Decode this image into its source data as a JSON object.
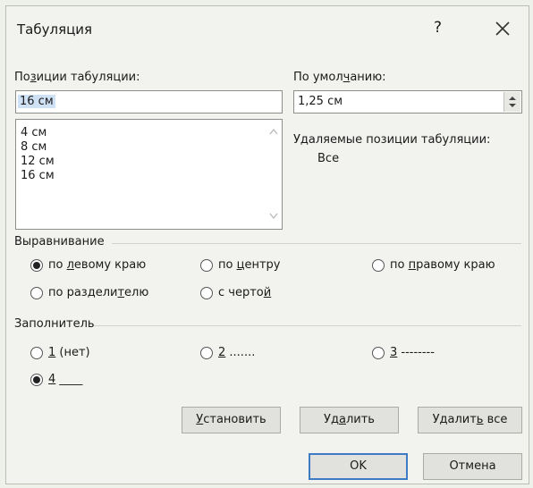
{
  "dialog": {
    "title": "Табуляция",
    "help_label": "?"
  },
  "tab_positions": {
    "label_pre": "По",
    "label_ul": "з",
    "label_post": "иции табуляции:",
    "input_value": "16 см",
    "items": [
      "4 см",
      "8 см",
      "12 см",
      "16 см"
    ]
  },
  "default_tabs": {
    "label_pre": "По умол",
    "label_ul": "ч",
    "label_post": "анию:",
    "value": "1,25 см"
  },
  "removed_tabs": {
    "label": "Удаляемые позиции табуляции:",
    "value": "Все"
  },
  "alignment": {
    "title": "Выравнивание",
    "left_pre": "по ",
    "left_ul": "л",
    "left_post": "евому краю",
    "center_pre": "по ",
    "center_ul": "ц",
    "center_post": "ентру",
    "right_pre": "по ",
    "right_ul": "п",
    "right_post": "равому краю",
    "decimal_pre": "по раздели",
    "decimal_ul": "т",
    "decimal_post": "елю",
    "bar_pre": "с черто",
    "bar_ul": "й",
    "bar_post": "",
    "selected": "left"
  },
  "leader": {
    "title": "Заполнитель",
    "opt1_ul": "1",
    "opt1_post": " (нет)",
    "opt2_ul": "2",
    "opt2_post": " .......",
    "opt3_ul": "3",
    "opt3_post": " --------",
    "opt4_ul": "4",
    "opt4_post": " ____",
    "selected": "4"
  },
  "buttons": {
    "set_ul": "У",
    "set_post": "становить",
    "clear_pre": "Уд",
    "clear_ul": "а",
    "clear_post": "лить",
    "clear_all_pre": "Удалит",
    "clear_all_ul": "ь",
    "clear_all_post": " все",
    "ok": "OK",
    "cancel": "Отмена"
  }
}
